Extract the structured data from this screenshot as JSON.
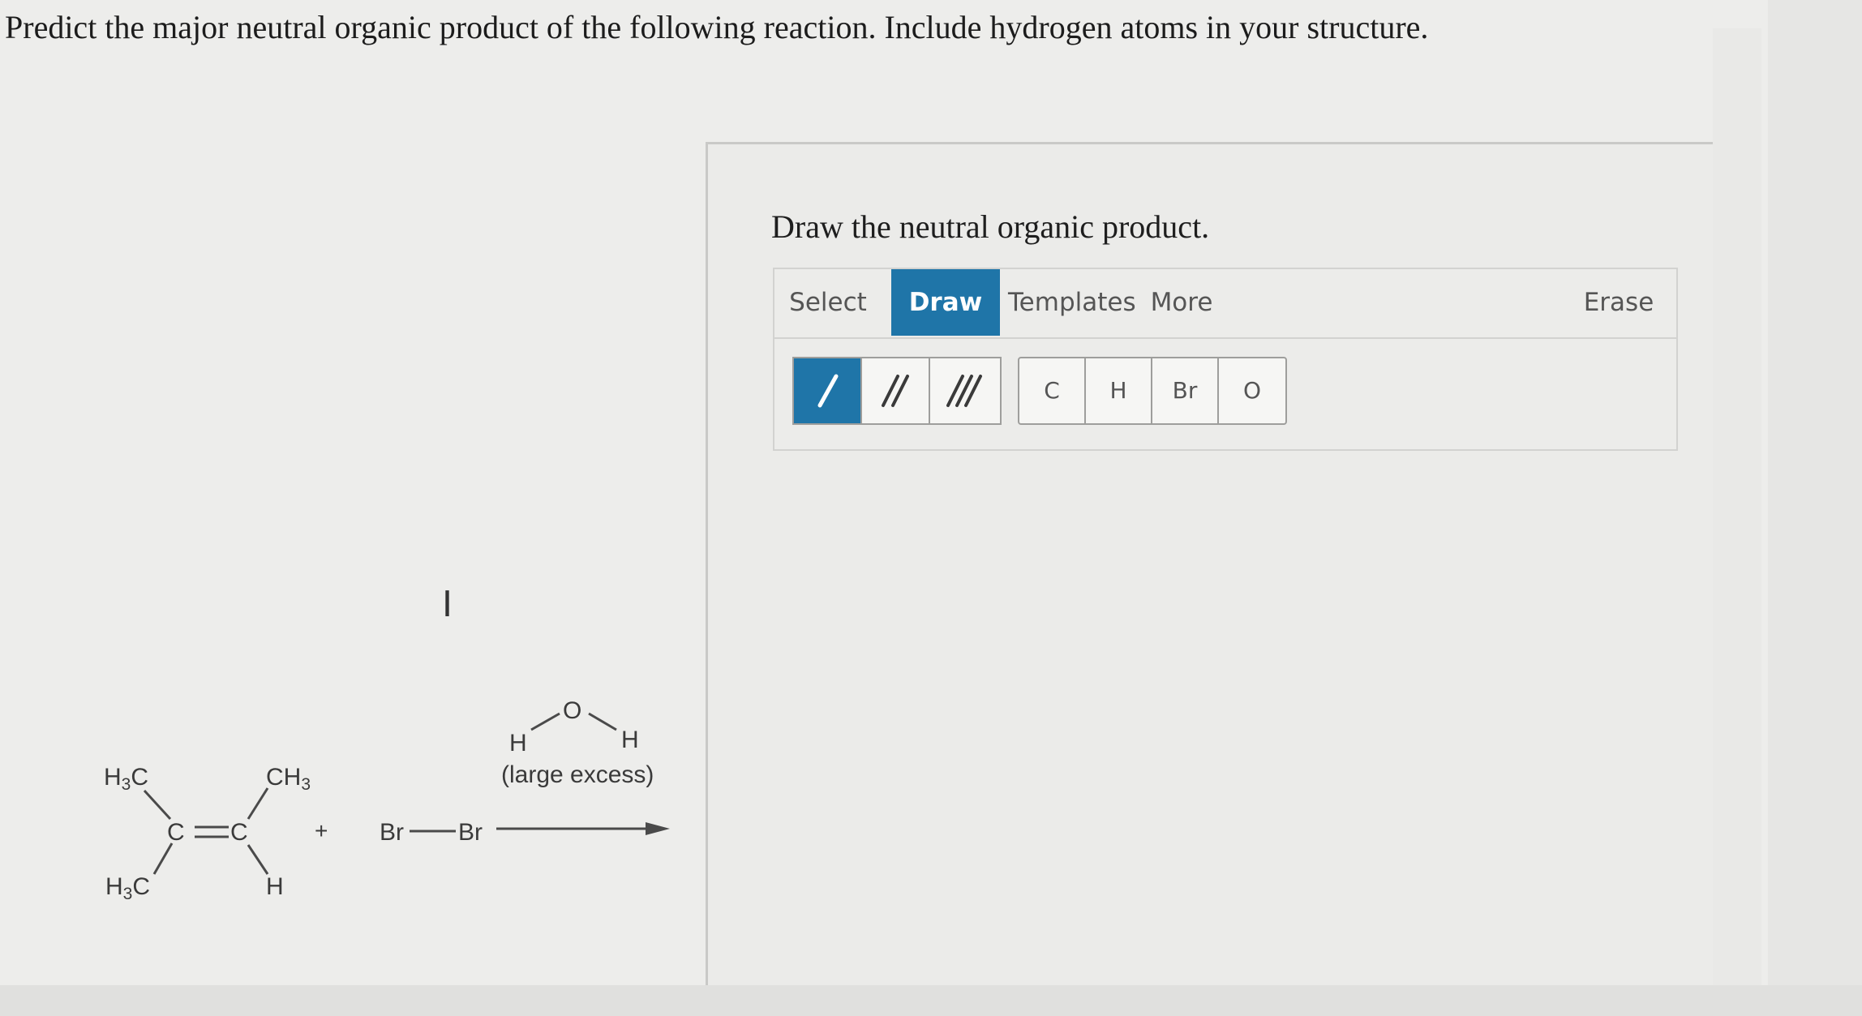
{
  "question": {
    "text": "Predict the major neutral organic product of the following reaction. Include hydrogen atoms in your structure."
  },
  "reaction": {
    "reactant_labels": {
      "h3c_top": "H3C",
      "h3c_bottom": "H3C",
      "ch3": "CH3",
      "c_left": "C",
      "c_right": "C",
      "h": "H"
    },
    "plus": "+",
    "bromine": {
      "br_left": "Br",
      "br_right": "Br"
    },
    "reagent": {
      "o": "O",
      "h_left": "H",
      "h_right": "H",
      "note": "(large excess)"
    }
  },
  "panel": {
    "title": "Draw the neutral organic product.",
    "tabs": [
      {
        "label": "Select",
        "active": false
      },
      {
        "label": "Draw",
        "active": true
      },
      {
        "label": "Templates",
        "active": false
      },
      {
        "label": "More",
        "active": false
      }
    ],
    "erase_label": "Erase",
    "bond_tools": [
      {
        "name": "single-bond",
        "active": true
      },
      {
        "name": "double-bond",
        "active": false
      },
      {
        "name": "triple-bond",
        "active": false
      }
    ],
    "atom_tools": [
      "C",
      "H",
      "Br",
      "O"
    ]
  },
  "colors": {
    "accent": "#1f75a8",
    "text": "#1e1e1e"
  },
  "icons": {
    "cursor": "text-cursor-icon"
  }
}
